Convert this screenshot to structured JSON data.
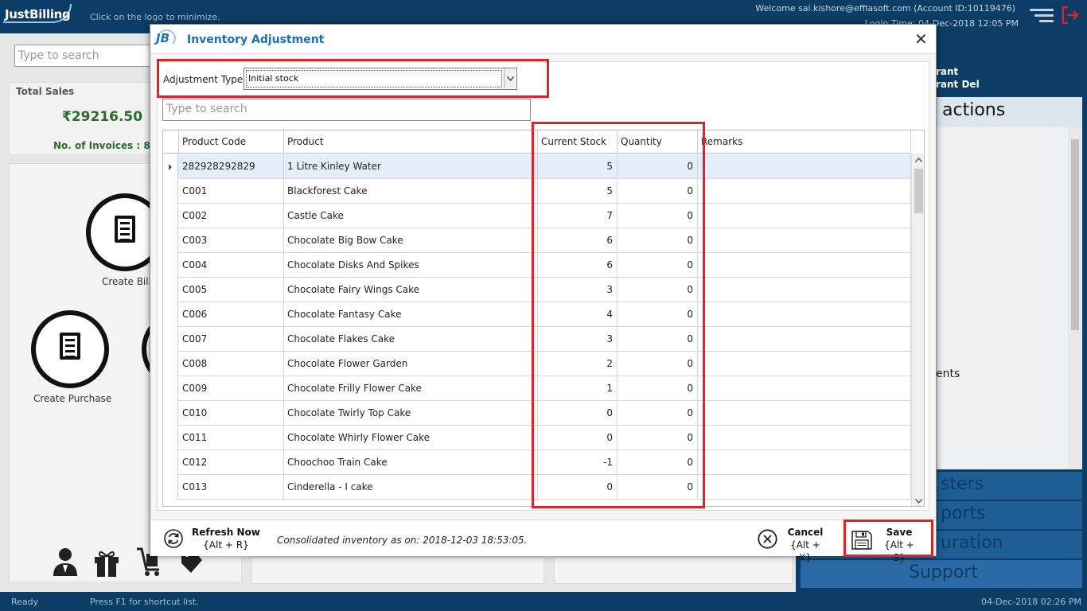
{
  "app": {
    "logo_text": "JustBilling",
    "hint": "Click on the logo to minimize.",
    "welcome": "Welcome sai.kishore@effiasoft.com (Account ID:10119476)",
    "login": "Login Time: 04-Dec-2018 12:05 PM"
  },
  "background": {
    "search_placeholder": "Type to search",
    "total_sales_label": "Total Sales",
    "total_sales_value": "₹29216.50",
    "invoices": "No. of Invoices : 8",
    "create_bill": "Create Bill",
    "create_purchase": "Create Purchase",
    "right": {
      "user1": "rant",
      "user2": "rant Del",
      "transactions": "actions",
      "item": "ents",
      "menu1": "sters",
      "menu2": "ports",
      "menu3": "uration",
      "support": "Support"
    }
  },
  "status": {
    "ready": "Ready",
    "shortcut": "Press F1 for shortcut list.",
    "datetime": "04-Dec-2018 02:26 PM"
  },
  "modal": {
    "title": "Inventory Adjustment",
    "adjustment_type_label": "Adjustment Type",
    "adjustment_type_value": "Initial stock",
    "search_placeholder": "Type to search",
    "columns": {
      "code": "Product Code",
      "product": "Product",
      "current_stock": "Current Stock",
      "quantity": "Quantity",
      "remarks": "Remarks"
    },
    "rows": [
      {
        "code": "282928292829",
        "product": "1 Litre Kinley Water",
        "stock": "5",
        "qty": "0"
      },
      {
        "code": "C001",
        "product": "Blackforest Cake",
        "stock": "5",
        "qty": "0"
      },
      {
        "code": "C002",
        "product": "Castle Cake",
        "stock": "7",
        "qty": "0"
      },
      {
        "code": "C003",
        "product": "Chocolate Big Bow Cake",
        "stock": "6",
        "qty": "0"
      },
      {
        "code": "C004",
        "product": "Chocolate Disks And Spikes",
        "stock": "6",
        "qty": "0"
      },
      {
        "code": "C005",
        "product": "Chocolate Fairy Wings Cake",
        "stock": "3",
        "qty": "0"
      },
      {
        "code": "C006",
        "product": "Chocolate Fantasy Cake",
        "stock": "4",
        "qty": "0"
      },
      {
        "code": "C007",
        "product": "Chocolate Flakes Cake",
        "stock": "3",
        "qty": "0"
      },
      {
        "code": "C008",
        "product": "Chocolate Flower Garden",
        "stock": "2",
        "qty": "0"
      },
      {
        "code": "C009",
        "product": "Chocolate Frilly Flower Cake",
        "stock": "1",
        "qty": "0"
      },
      {
        "code": "C010",
        "product": "Chocolate Twirly Top Cake",
        "stock": "0",
        "qty": "0"
      },
      {
        "code": "C011",
        "product": "Chocolate Whirly Flower Cake",
        "stock": "0",
        "qty": "0"
      },
      {
        "code": "C012",
        "product": "Choochoo Train Cake",
        "stock": "-1",
        "qty": "0"
      },
      {
        "code": "C013",
        "product": "Cinderella - I cake",
        "stock": "0",
        "qty": "0"
      }
    ],
    "footer": {
      "refresh_label": "Refresh Now",
      "refresh_shortcut": "{Alt + R}",
      "consolidated": "Consolidated inventory as on: 2018-12-03 18:53:05.",
      "cancel_label": "Cancel",
      "cancel_shortcut": "{Alt + X}",
      "save_label": "Save",
      "save_shortcut": "{Alt + S}"
    }
  },
  "colors": {
    "brand_dark": "#0b3d66",
    "title_blue": "#1a6fb5",
    "highlight_red": "#d9232d",
    "selected_row": "#e3eefa"
  }
}
